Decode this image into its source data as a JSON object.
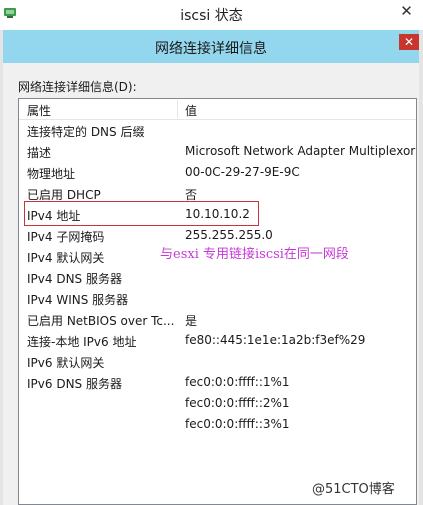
{
  "outer_window": {
    "title": "iscsi 状态",
    "close_symbol": "✕"
  },
  "dialog": {
    "title": "网络连接详细信息",
    "close_symbol": "✕",
    "section_label": "网络连接详细信息(D):",
    "columns": [
      "属性",
      "值"
    ],
    "rows": [
      {
        "prop": "连接特定的 DNS 后缀",
        "value": ""
      },
      {
        "prop": "描述",
        "value": "Microsoft Network Adapter Multiplexor"
      },
      {
        "prop": "物理地址",
        "value": "00-0C-29-27-9E-9C"
      },
      {
        "prop": "已启用 DHCP",
        "value": "否"
      },
      {
        "prop": "IPv4 地址",
        "value": "10.10.10.2"
      },
      {
        "prop": "IPv4 子网掩码",
        "value": "255.255.255.0"
      },
      {
        "prop": "IPv4 默认网关",
        "value": ""
      },
      {
        "prop": "IPv4 DNS 服务器",
        "value": ""
      },
      {
        "prop": "IPv4 WINS 服务器",
        "value": ""
      },
      {
        "prop": "已启用 NetBIOS over Tc...",
        "value": "是"
      },
      {
        "prop": "连接-本地 IPv6 地址",
        "value": "fe80::445:1e1e:1a2b:f3ef%29"
      },
      {
        "prop": "IPv6 默认网关",
        "value": ""
      },
      {
        "prop": "IPv6 DNS 服务器",
        "value": "fec0:0:0:ffff::1%1"
      },
      {
        "prop": "",
        "value": "fec0:0:0:ffff::2%1"
      },
      {
        "prop": "",
        "value": "fec0:0:0:ffff::3%1"
      }
    ]
  },
  "annotation": {
    "note": "与esxi 专用链接iscsi在同一网段",
    "highlight_color": "#c8343c",
    "note_color": "#c838d8"
  },
  "watermark": "@51CTO博客",
  "colors": {
    "dialog_titlebar": "#93d7ef",
    "close_button": "#c7362c",
    "dialog_background": "#f0f0f0"
  },
  "icons": {
    "outer_app_icon": "network-adapter-icon"
  }
}
